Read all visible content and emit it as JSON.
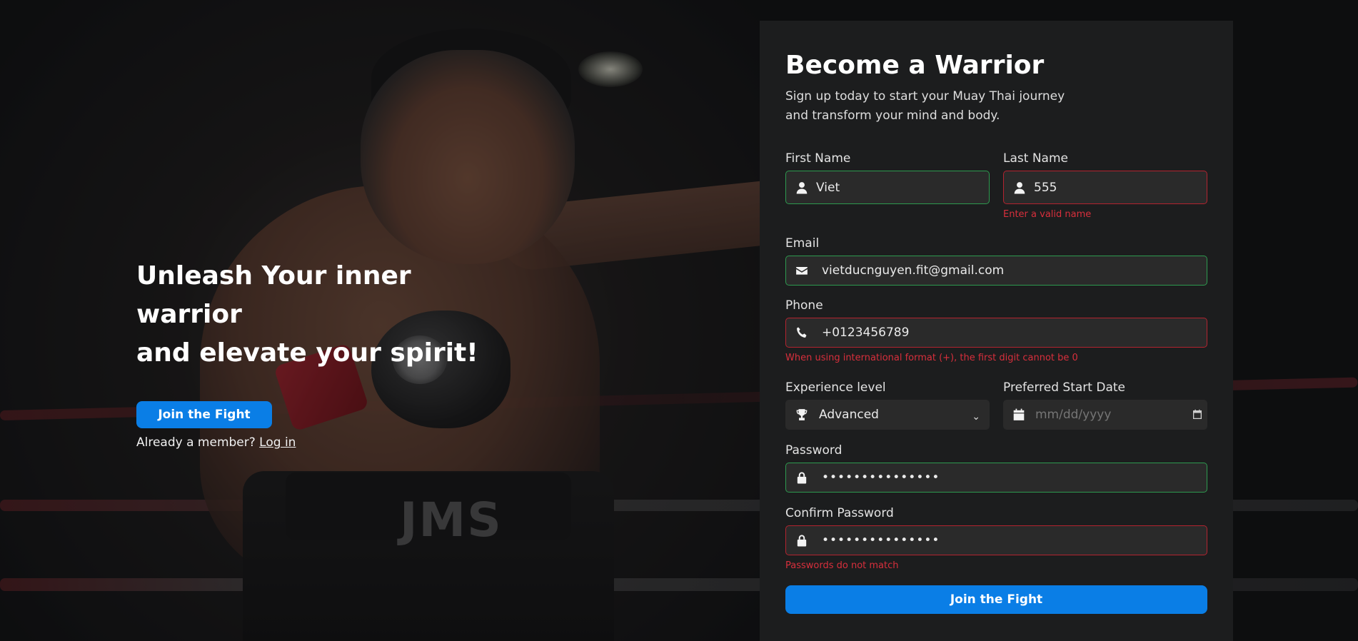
{
  "hero": {
    "headline_line1": "Unleash Your inner warrior",
    "headline_line2": "and elevate your spirit!",
    "cta_label": "Join the Fight",
    "member_text": "Already a member?",
    "login_link": "Log in",
    "background_mark": "JMS"
  },
  "form": {
    "title": "Become a Warrior",
    "subtitle": "Sign up today to start your Muay Thai journey and transform your mind and body.",
    "first_name": {
      "label": "First Name",
      "value": "Viet",
      "icon": "user-icon",
      "status": "valid"
    },
    "last_name": {
      "label": "Last Name",
      "value": "555",
      "icon": "user-icon",
      "status": "invalid",
      "error": "Enter a valid name"
    },
    "email": {
      "label": "Email",
      "value": "vietducnguyen.fit@gmail.com",
      "icon": "envelope-icon",
      "status": "valid"
    },
    "phone": {
      "label": "Phone",
      "value": "+0123456789",
      "icon": "phone-icon",
      "status": "invalid",
      "error": "When using international format (+), the first digit cannot be 0"
    },
    "experience": {
      "label": "Experience level",
      "selected": "Advanced",
      "icon": "trophy-icon"
    },
    "start_date": {
      "label": "Preferred Start Date",
      "placeholder": "mm/dd/yyyy",
      "icon": "calendar-icon"
    },
    "password": {
      "label": "Password",
      "value": "•••••••••••••••",
      "icon": "lock-icon",
      "status": "valid"
    },
    "confirm_password": {
      "label": "Confirm Password",
      "value": "•••••••••••••••",
      "icon": "lock-icon",
      "status": "invalid",
      "error": "Passwords do not match"
    },
    "submit_label": "Join the Fight"
  },
  "colors": {
    "accent": "#0a7ee6",
    "valid": "#2d9a4f",
    "invalid": "#b3232f",
    "error_text": "#d82f3c",
    "card_bg": "#1c1d1e"
  }
}
